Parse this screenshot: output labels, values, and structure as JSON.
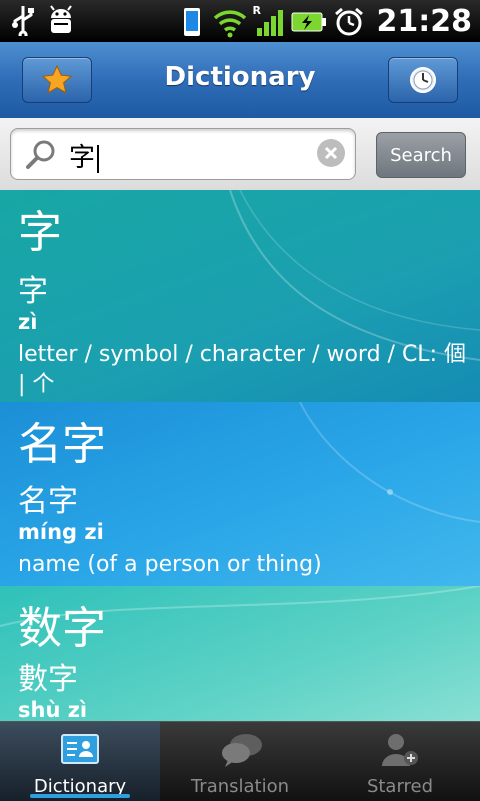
{
  "status_bar": {
    "time": "21:28",
    "icons": [
      "usb-icon",
      "android-debug-icon",
      "phone-icon",
      "wifi-icon",
      "roaming-indicator",
      "signal-icon",
      "battery-charging-icon",
      "alarm-icon"
    ],
    "roaming_label": "R"
  },
  "title_bar": {
    "title": "Dictionary",
    "left_icon": "star-icon",
    "right_icon": "clock-icon"
  },
  "search": {
    "value": "字",
    "button_label": "Search"
  },
  "results": [
    {
      "headword": "字",
      "traditional": "字",
      "pinyin": "zì",
      "definition": "letter  / symbol  / character  / word  / CL: 個 | 个"
    },
    {
      "headword": "名字",
      "traditional": "名字",
      "pinyin": "míng zi",
      "definition": "name (of a person or thing)"
    },
    {
      "headword": "数字",
      "traditional": "數字",
      "pinyin": "shù zì",
      "definition": ""
    }
  ],
  "tabs": [
    {
      "label": "Dictionary",
      "icon": "dictionary-card-icon",
      "active": true
    },
    {
      "label": "Translation",
      "icon": "speech-bubbles-icon",
      "active": false
    },
    {
      "label": "Starred",
      "icon": "add-person-icon",
      "active": false
    }
  ],
  "colors": {
    "title_bar": "#2f6db8",
    "accent": "#2f9fe0",
    "star": "#f6a623"
  }
}
